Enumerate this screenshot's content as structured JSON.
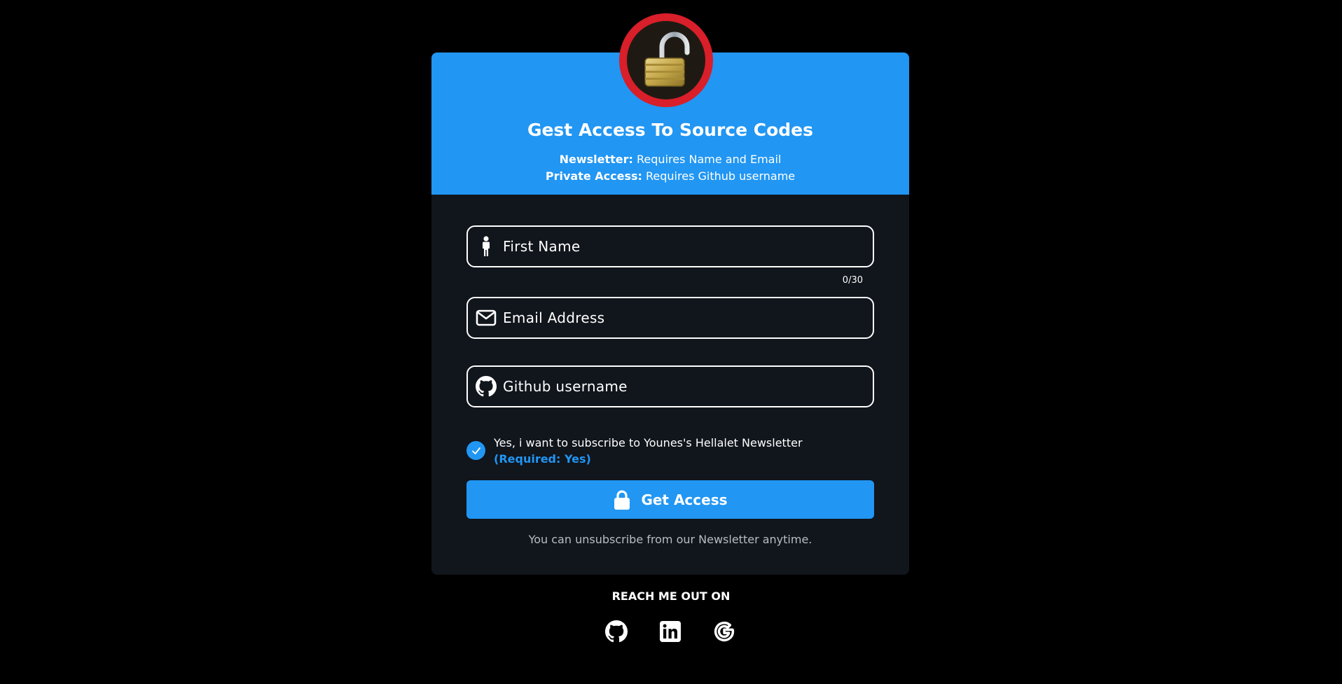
{
  "header": {
    "title": "Gest Access To Source Codes",
    "newsletter_label": "Newsletter:",
    "newsletter_text": "Requires Name and Email",
    "private_label": "Private Access:",
    "private_text": "Requires Github username"
  },
  "form": {
    "first_name": {
      "placeholder": "First Name",
      "value": "",
      "icon": "person-icon",
      "counter": "0/30"
    },
    "email": {
      "placeholder": "Email Address",
      "value": "",
      "icon": "envelope-icon"
    },
    "github": {
      "placeholder": "Github username",
      "value": "",
      "icon": "github-icon"
    },
    "subscribe": {
      "checked": true,
      "label": "Yes, i want to subscribe to Younes's Hellalet Newsletter",
      "required": "(Required: Yes)"
    },
    "submit_label": "Get Access",
    "note": "You can unsubscribe from our Newsletter anytime."
  },
  "footer": {
    "heading": "REACH ME OUT ON",
    "links": [
      "github-icon",
      "linkedin-icon",
      "google-icon"
    ]
  },
  "colors": {
    "accent": "#2196f3",
    "card": "#11151c",
    "badge_ring": "#d81f2a",
    "background": "#000000"
  }
}
